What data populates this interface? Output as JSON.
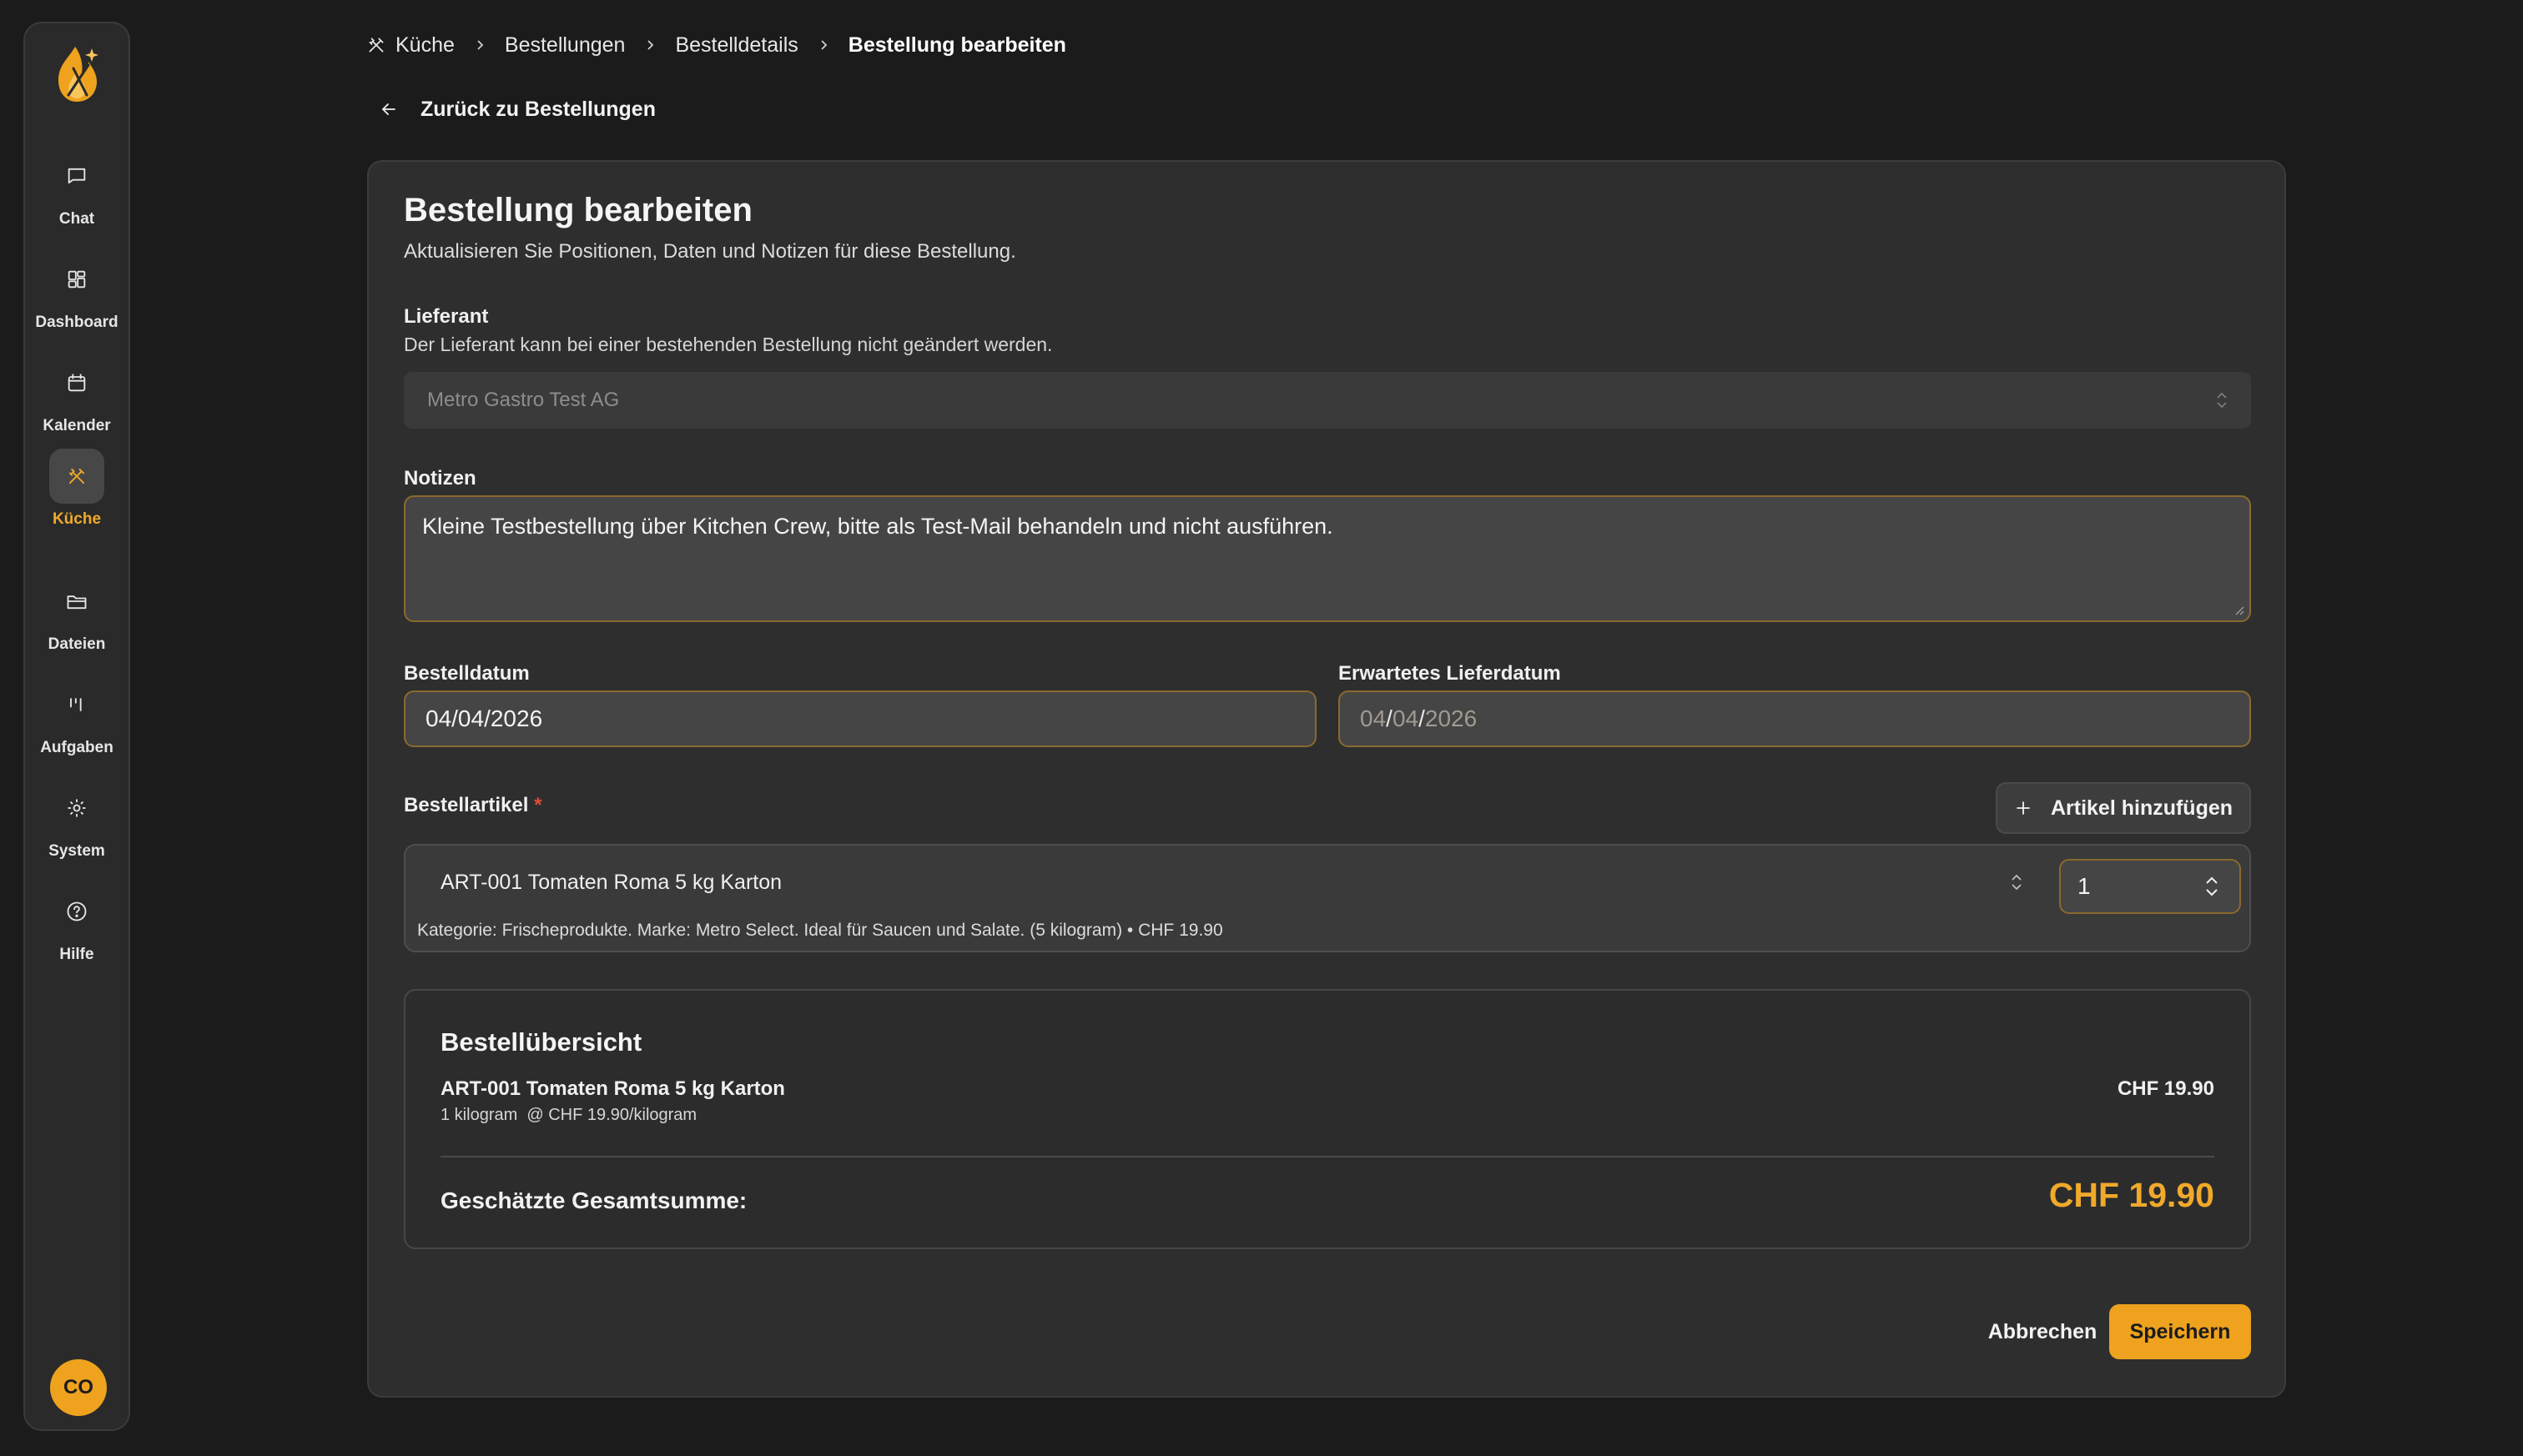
{
  "sidebar": {
    "logo_icon": "flame-utensils-logo",
    "items": [
      {
        "label": "Chat",
        "icon": "chat-icon"
      },
      {
        "label": "Dashboard",
        "icon": "dashboard-icon"
      },
      {
        "label": "Kalender",
        "icon": "calendar-icon"
      },
      {
        "label": "Küche",
        "icon": "utensils-icon",
        "active": true
      },
      {
        "label": "Dateien",
        "icon": "folder-icon"
      },
      {
        "label": "Aufgaben",
        "icon": "tasks-icon"
      },
      {
        "label": "System",
        "icon": "gear-icon"
      },
      {
        "label": "Hilfe",
        "icon": "help-icon"
      }
    ],
    "avatar": "CO"
  },
  "breadcrumb": {
    "items": [
      "Küche",
      "Bestellungen",
      "Bestelldetails",
      "Bestellung bearbeiten"
    ]
  },
  "back_link": "Zurück zu Bestellungen",
  "form": {
    "title": "Bestellung bearbeiten",
    "subtitle": "Aktualisieren Sie Positionen, Daten und Notizen für diese Bestellung.",
    "supplier": {
      "label": "Lieferant",
      "help": "Der Lieferant kann bei einer bestehenden Bestellung nicht geändert werden.",
      "value": "Metro Gastro Test AG"
    },
    "notes": {
      "label": "Notizen",
      "value": "Kleine Testbestellung über Kitchen Crew, bitte als Test-Mail behandeln und nicht ausführen."
    },
    "order_date": {
      "label": "Bestelldatum",
      "value": "04/04/2026"
    },
    "delivery_date": {
      "label": "Erwartetes Lieferdatum",
      "mm": "04",
      "dd": "04",
      "yyyy": "2026"
    },
    "items": {
      "label": "Bestellartikel",
      "required_mark": "*",
      "add_button": "Artikel hinzufügen",
      "rows": [
        {
          "product": "ART-001 Tomaten Roma 5 kg Karton",
          "quantity": "1",
          "meta": "Kategorie: Frischeprodukte. Marke: Metro Select. Ideal für Saucen und Salate. (5 kilogram) • CHF 19.90"
        }
      ]
    },
    "summary": {
      "title": "Bestellübersicht",
      "lines": [
        {
          "name": "ART-001 Tomaten Roma 5 kg Karton",
          "detail": "1 kilogram  @ CHF 19.90/kilogram",
          "price": "CHF 19.90"
        }
      ],
      "total_label": "Geschätzte Gesamtsumme:",
      "total_value": "CHF 19.90"
    },
    "cancel_button": "Abbrechen",
    "save_button": "Speichern"
  },
  "colors": {
    "background": "#1b1b1b",
    "card": "#2e2e2e",
    "accent": "#eea21e",
    "field_border": "#8a6a2e"
  }
}
